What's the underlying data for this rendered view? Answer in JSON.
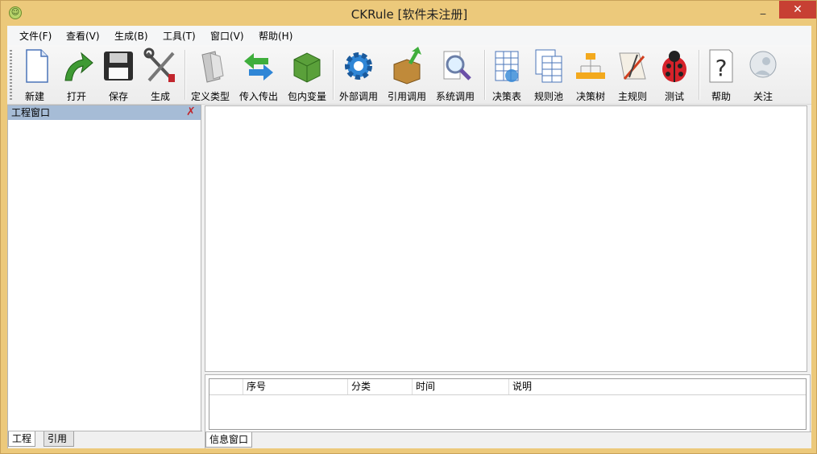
{
  "window": {
    "title": "CKRule [软件未注册]",
    "minimize": "_",
    "maximize": "□",
    "close": "✕"
  },
  "menu": [
    "文件(F)",
    "查看(V)",
    "生成(B)",
    "工具(T)",
    "窗口(V)",
    "帮助(H)"
  ],
  "toolbar": [
    {
      "label": "新建",
      "icon": "new-file-icon"
    },
    {
      "label": "打开",
      "icon": "open-arrow-icon"
    },
    {
      "label": "保存",
      "icon": "save-floppy-icon"
    },
    {
      "label": "生成",
      "icon": "build-tools-icon"
    },
    {
      "label": "定义类型",
      "icon": "define-type-icon"
    },
    {
      "label": "传入传出",
      "icon": "in-out-arrows-icon"
    },
    {
      "label": "包内变量",
      "icon": "package-box-icon"
    },
    {
      "label": "外部调用",
      "icon": "gear-icon"
    },
    {
      "label": "引用调用",
      "icon": "reference-box-icon"
    },
    {
      "label": "系统调用",
      "icon": "magnifier-icon"
    },
    {
      "label": "决策表",
      "icon": "decision-table-icon"
    },
    {
      "label": "规则池",
      "icon": "rule-pool-icon"
    },
    {
      "label": "决策树",
      "icon": "decision-tree-icon"
    },
    {
      "label": "主规则",
      "icon": "main-rule-icon"
    },
    {
      "label": "测试",
      "icon": "ladybug-icon"
    },
    {
      "label": "帮助",
      "icon": "help-icon"
    },
    {
      "label": "关注",
      "icon": "follow-icon"
    }
  ],
  "project_pane": {
    "title": "工程窗口",
    "tabs": [
      "工程",
      "引用"
    ]
  },
  "info_pane": {
    "columns": [
      "序号",
      "分类",
      "时间",
      "说明"
    ],
    "tab": "信息窗口"
  }
}
